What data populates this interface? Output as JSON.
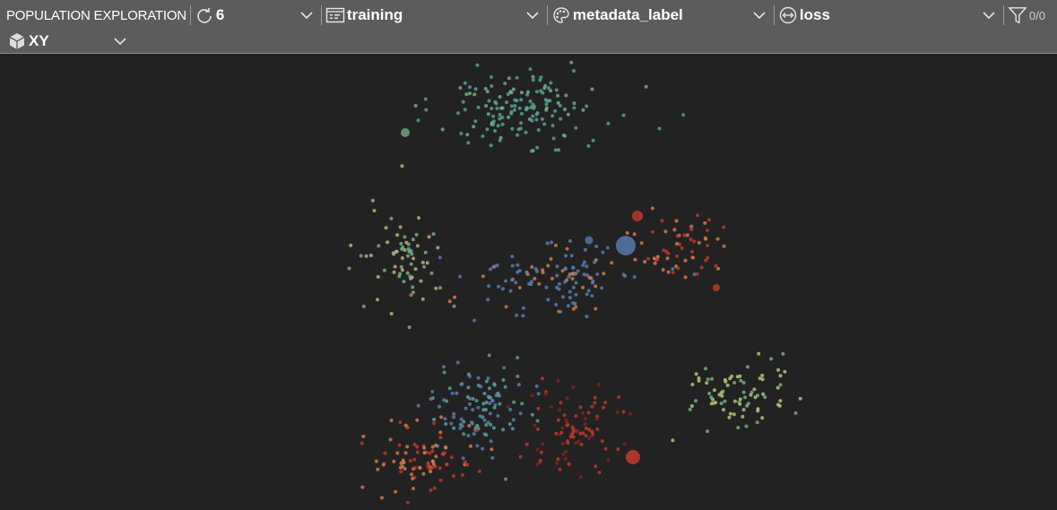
{
  "panel": {
    "title": "POPULATION EXPLORATION"
  },
  "controls": {
    "epoch": {
      "value": "6",
      "icon": "refresh-icon"
    },
    "dataset": {
      "value": "training",
      "icon": "table-icon"
    },
    "color_by": {
      "value": "metadata_label",
      "icon": "palette-icon"
    },
    "size_by": {
      "value": "loss",
      "icon": "width-arrows-icon"
    },
    "filter": {
      "value": "0/0",
      "icon": "filter-icon"
    },
    "projection": {
      "value": "XY",
      "icon": "cube-icon"
    }
  },
  "colors": {
    "background": "#222222",
    "toolbar": "#5c5c5c",
    "teal": "#5aa89a",
    "green": "#7bb58a",
    "yellow": "#c9b87a",
    "blue": "#5b7fb8",
    "orange": "#d98050",
    "red": "#c6392d",
    "darkred": "#8a231c",
    "lime": "#b8cf7a"
  }
}
